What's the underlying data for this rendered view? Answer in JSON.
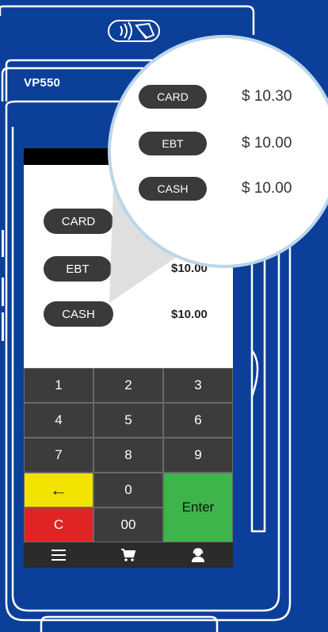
{
  "device": {
    "model": "VP550"
  },
  "icons": {
    "contactless": "contactless-icon",
    "menu": "menu-icon",
    "cart": "cart-icon",
    "support": "support-agent-icon"
  },
  "colors": {
    "device_blue": "#0b3f9a",
    "pill": "#3a3a3a",
    "back_key": "#f3e300",
    "clear_key": "#e02424",
    "enter_key": "#3db54a"
  },
  "screen": {
    "tenders": [
      {
        "label": "CARD",
        "amount": ""
      },
      {
        "label": "EBT",
        "amount": "$10.00"
      },
      {
        "label": "CASH",
        "amount": "$10.00"
      }
    ]
  },
  "zoom": {
    "tenders": [
      {
        "label": "CARD",
        "amount": "$ 10.30"
      },
      {
        "label": "EBT",
        "amount": "$ 10.00"
      },
      {
        "label": "CASH",
        "amount": "$ 10.00"
      }
    ]
  },
  "keypad": {
    "k1": "1",
    "k2": "2",
    "k3": "3",
    "k4": "4",
    "k5": "5",
    "k6": "6",
    "k7": "7",
    "k8": "8",
    "k9": "9",
    "back": "←",
    "k0": "0",
    "enter": "Enter",
    "clear": "C",
    "k00": "00"
  }
}
